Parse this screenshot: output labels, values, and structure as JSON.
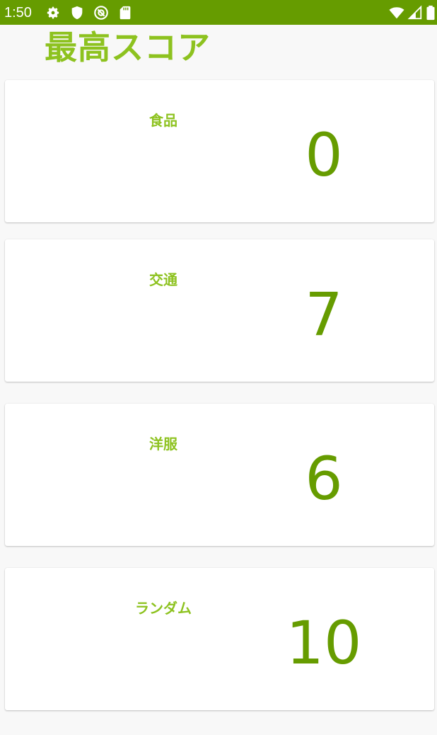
{
  "status_bar": {
    "time": "1:50",
    "background": "#669c00",
    "left_icons": [
      "gear-icon",
      "shield-icon",
      "at-sign-icon",
      "sd-card-icon"
    ],
    "right_icons": [
      "wifi-icon",
      "cell-signal-icon",
      "battery-icon"
    ]
  },
  "header": {
    "title": "最高スコア"
  },
  "colors": {
    "accent_light": "#8dc21f",
    "accent_dark": "#669c00",
    "background": "#f8f8f8",
    "card": "#ffffff"
  },
  "scores": [
    {
      "category": "食品",
      "score": "0"
    },
    {
      "category": "交通",
      "score": "7"
    },
    {
      "category": "洋服",
      "score": "6"
    },
    {
      "category": "ランダム",
      "score": "10"
    }
  ]
}
